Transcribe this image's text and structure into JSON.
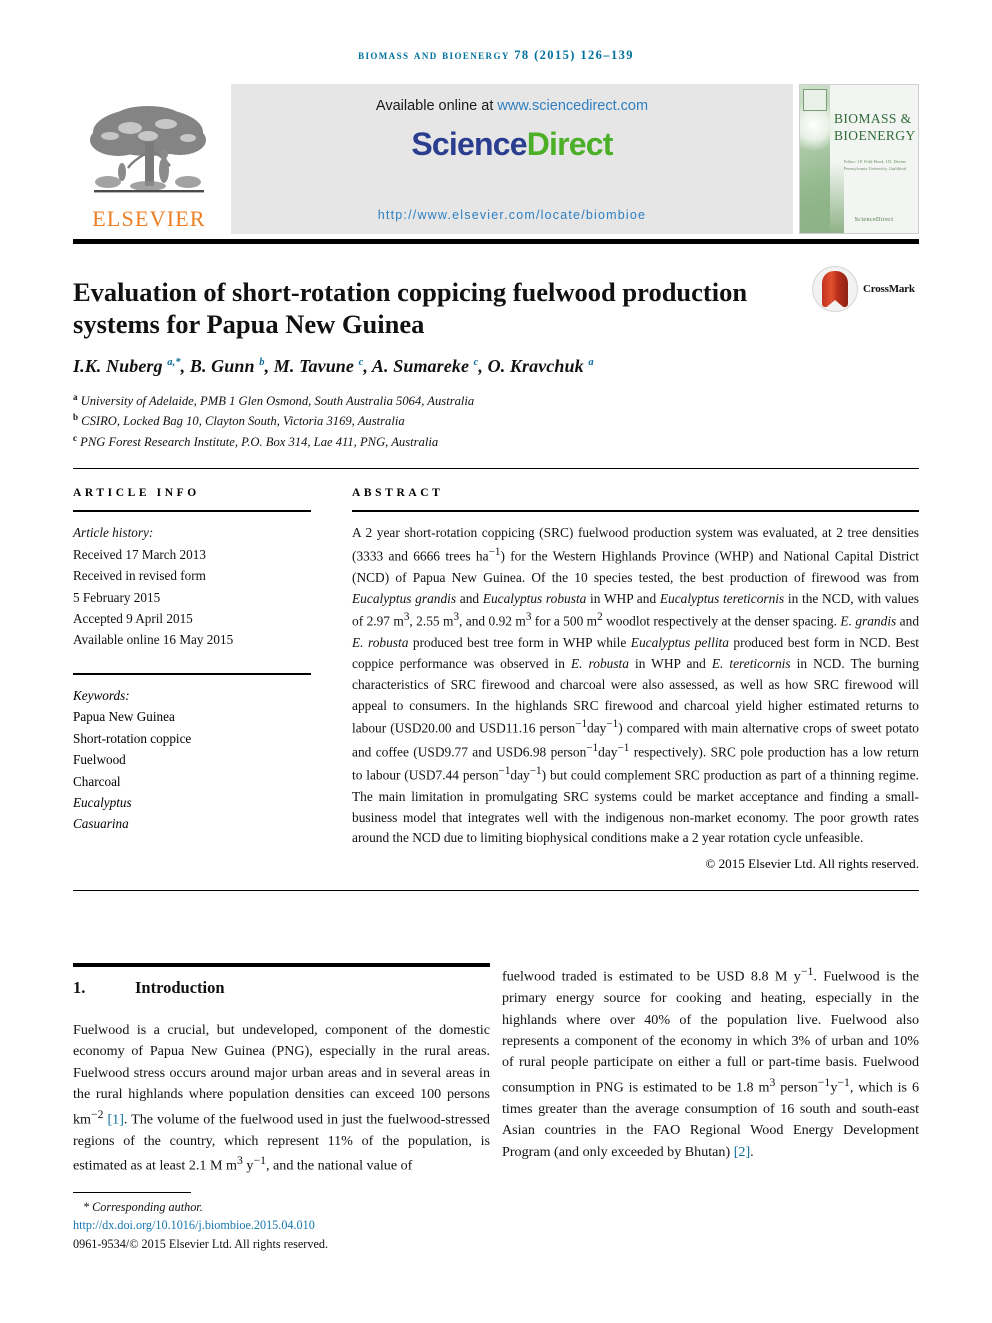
{
  "running_head": "Biomass and Bioenergy 78 (2015) 126–139",
  "masthead": {
    "publisher_name": "ELSEVIER",
    "publisher_logo_alt": "elsevier-tree-logo",
    "available_prefix": "Available online at ",
    "available_url": "www.sciencedirect.com",
    "sciencedirect_part1": "Science",
    "sciencedirect_part2": "Direct",
    "journal_url": "http://www.elsevier.com/locate/biombioe",
    "cover": {
      "title_line1": "BIOMASS &",
      "title_line2": "BIOENERGY",
      "subtitle": "Editor: J.P. Pohl-Hood, I.D. Devine\nPennsylvania University, Guildford",
      "footer": "ScienceDirect"
    }
  },
  "article": {
    "title": "Evaluation of short-rotation coppicing fuelwood production systems for Papua New Guinea",
    "crossmark_label": "CrossMark",
    "authors_html": "I.K. Nuberg <sup>a,*</sup>, B. Gunn <sup>b</sup>, M. Tavune <sup>c</sup>, A. Sumareke <sup>c</sup>, O. Kravchuk <sup>a</sup>",
    "affiliations": [
      {
        "marker": "a",
        "text": "University of Adelaide, PMB 1 Glen Osmond, South Australia 5064, Australia"
      },
      {
        "marker": "b",
        "text": "CSIRO, Locked Bag 10, Clayton South, Victoria 3169, Australia"
      },
      {
        "marker": "c",
        "text": "PNG Forest Research Institute, P.O. Box 314, Lae 411, PNG, Australia"
      }
    ]
  },
  "article_info": {
    "heading": "ARTICLE INFO",
    "history_label": "Article history:",
    "history": [
      "Received 17 March 2013",
      "Received in revised form",
      "5 February 2015",
      "Accepted 9 April 2015",
      "Available online 16 May 2015"
    ],
    "keywords_label": "Keywords:",
    "keywords": [
      "Papua New Guinea",
      "Short-rotation coppice",
      "Fuelwood",
      "Charcoal",
      "Eucalyptus",
      "Casuarina"
    ]
  },
  "abstract": {
    "heading": "ABSTRACT",
    "body_html": "A 2 year short-rotation coppicing (SRC) fuelwood production system was evaluated, at 2 tree densities (3333 and 6666 trees ha<sup>−1</sup>) for the Western Highlands Province (WHP) and National Capital District (NCD) of Papua New Guinea. Of the 10 species tested, the best production of firewood was from <i>Eucalyptus grandis</i> and <i>Eucalyptus robusta</i> in WHP and <i>Eucalyptus tereticornis</i> in the NCD, with values of 2.97 m<sup>3</sup>, 2.55 m<sup>3</sup>, and 0.92 m<sup>3</sup> for a 500 m<sup>2</sup> woodlot respectively at the denser spacing. <i>E. grandis</i> and <i>E. robusta</i> produced best tree form in WHP while <i>Eucalyptus pellita</i> produced best form in NCD. Best coppice performance was observed in <i>E. robusta</i> in WHP and <i>E. tereticornis</i> in NCD. The burning characteristics of SRC firewood and charcoal were also assessed, as well as how SRC firewood will appeal to consumers. In the highlands SRC firewood and charcoal yield higher estimated returns to labour (USD20.00 and USD11.16 person<sup>−1</sup>day<sup>−1</sup>) compared with main alternative crops of sweet potato and coffee (USD9.77 and USD6.98 person<sup>−1</sup>day<sup>−1</sup> respectively). SRC pole production has a low return to labour (USD7.44 person<sup>−1</sup>day<sup>−1</sup>) but could complement SRC production as part of a thinning regime. The main limitation in promulgating SRC systems could be market acceptance and finding a small-business model that integrates well with the indigenous non-market economy. The poor growth rates around the NCD due to limiting biophysical conditions make a 2 year rotation cycle unfeasible.",
    "copyright": "© 2015 Elsevier Ltd. All rights reserved."
  },
  "introduction": {
    "number": "1.",
    "heading": "Introduction",
    "paragraph_left_html": "Fuelwood is a crucial, but undeveloped, component of the domestic economy of Papua New Guinea (PNG), especially in the rural areas. Fuelwood stress occurs around major urban areas and in several areas in the rural highlands where population densities can exceed 100 persons km<sup>−2</sup> <span class=\"ref\">[1]</span>. The volume of the fuelwood used in just the fuelwood-stressed regions of the country, which represent 11% of the population, is estimated as at least 2.1 M m<sup>3</sup> y<sup>−1</sup>, and the national value of",
    "paragraph_right_html": "fuelwood traded is estimated to be USD 8.8 M y<sup>−1</sup>. Fuelwood is the primary energy source for cooking and heating, especially in the highlands where over 40% of the population live. Fuelwood also represents a component of the economy in which 3% of urban and 10% of rural people participate on either a full or part-time basis. Fuelwood consumption in PNG is estimated to be 1.8 m<sup>3</sup> person<sup>−1</sup>y<sup>−1</sup>, which is 6 times greater than the average consumption of 16 south and south-east Asian countries in the FAO Regional Wood Energy Development Program (and only exceeded by Bhutan) <span class=\"ref\">[2]</span>."
  },
  "footer": {
    "corresponding_author": "* Corresponding author.",
    "doi": "http://dx.doi.org/10.1016/j.biombioe.2015.04.010",
    "issn_line": "0961-9534/© 2015 Elsevier Ltd. All rights reserved."
  }
}
